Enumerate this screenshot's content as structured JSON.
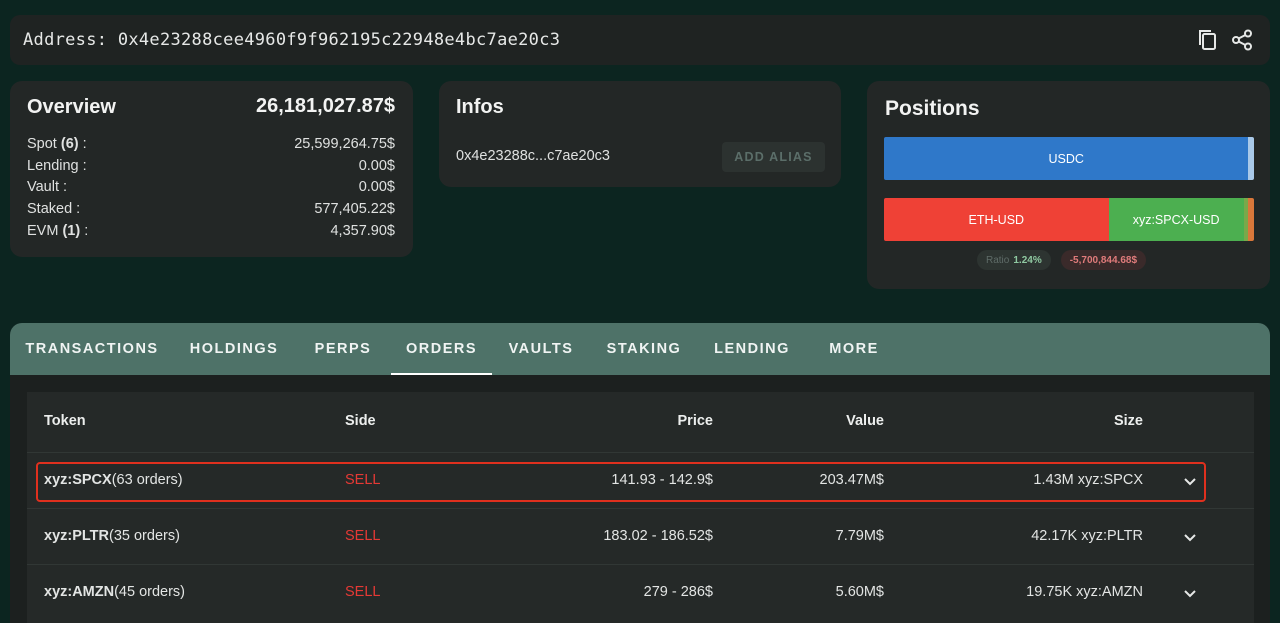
{
  "address": {
    "label": "Address: 0x4e23288cee4960f9f962195c22948e4bc7ae20c3",
    "icons": [
      "copy-icon",
      "share-icon"
    ]
  },
  "overview": {
    "title": "Overview",
    "total": "26,181,027.87$",
    "rows": [
      {
        "label": "Spot",
        "count": "(6)",
        "suffix": " :",
        "value": "25,599,264.75$"
      },
      {
        "label": "Lending",
        "count": "",
        "suffix": " :",
        "value": "0.00$"
      },
      {
        "label": "Vault",
        "count": "",
        "suffix": " :",
        "value": "0.00$"
      },
      {
        "label": "Staked",
        "count": "",
        "suffix": " :",
        "value": "577,405.22$"
      },
      {
        "label": "EVM",
        "count": "(1)",
        "suffix": " :",
        "value": "4,357.90$"
      }
    ]
  },
  "infos": {
    "title": "Infos",
    "short_address": "0x4e23288c...c7ae20c3",
    "add_alias_label": "ADD ALIAS"
  },
  "positions": {
    "title": "Positions",
    "spot_bar": [
      {
        "label": "USDC",
        "share": 0.985,
        "color": "#2f78c9"
      },
      {
        "label": "",
        "share": 0.015,
        "color": "#a9c9e8"
      }
    ],
    "perp_bar": [
      {
        "label": "ETH-USD",
        "share": 0.607,
        "color": "#ef4136"
      },
      {
        "label": "xyz:SPCX-USD",
        "share": 0.365,
        "color": "#4caf50"
      },
      {
        "label": "",
        "share": 0.012,
        "color": "#7aa84a"
      },
      {
        "label": "",
        "share": 0.016,
        "color": "#d9773a"
      }
    ],
    "ratio_label": "Ratio",
    "ratio_value": "1.24%",
    "pnl": "-5,700,844.68$"
  },
  "tabs": [
    {
      "label": "TRANSACTIONS",
      "active": false
    },
    {
      "label": "HOLDINGS",
      "active": false
    },
    {
      "label": "PERPS",
      "active": false
    },
    {
      "label": "ORDERS",
      "active": true
    },
    {
      "label": "VAULTS",
      "active": false
    },
    {
      "label": "STAKING",
      "active": false
    },
    {
      "label": "LENDING",
      "active": false
    },
    {
      "label": "MORE",
      "active": false
    }
  ],
  "orders": {
    "columns": [
      "Token",
      "Side",
      "Price",
      "Value",
      "Size"
    ],
    "rows": [
      {
        "token": "xyz:SPCX",
        "orders": "(63 orders)",
        "side": "SELL",
        "price": "141.93 - 142.9$",
        "value": "203.47M$",
        "size": "1.43M xyz:SPCX",
        "highlighted": true
      },
      {
        "token": "xyz:PLTR",
        "orders": "(35 orders)",
        "side": "SELL",
        "price": "183.02 - 186.52$",
        "value": "7.79M$",
        "size": "42.17K xyz:PLTR",
        "highlighted": false
      },
      {
        "token": "xyz:AMZN",
        "orders": "(45 orders)",
        "side": "SELL",
        "price": "279 - 286$",
        "value": "5.60M$",
        "size": "19.75K xyz:AMZN",
        "highlighted": false
      }
    ]
  },
  "colors": {
    "background": "#0c2520",
    "tab_bar": "#4e7268",
    "sell": "#e53935",
    "highlight_border": "#e0301e"
  }
}
